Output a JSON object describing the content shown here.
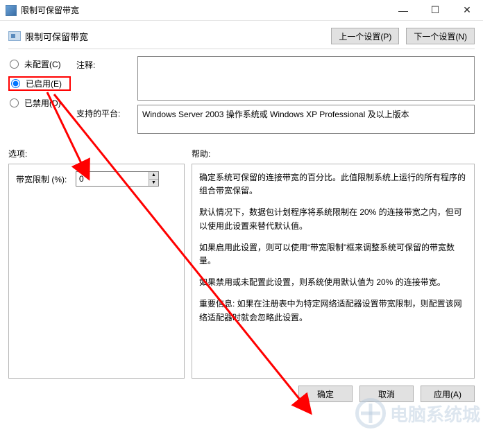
{
  "window": {
    "title": "限制可保留带宽",
    "min_icon": "—",
    "max_icon": "☐",
    "close_icon": "✕"
  },
  "header": {
    "title": "限制可保留带宽",
    "prev_btn": "上一个设置(P)",
    "next_btn": "下一个设置(N)"
  },
  "radios": {
    "not_configured": "未配置(C)",
    "enabled": "已启用(E)",
    "disabled": "已禁用(D)",
    "selected": "enabled"
  },
  "comment": {
    "label": "注释:",
    "value": ""
  },
  "platform": {
    "label": "支持的平台:",
    "value": "Windows Server 2003 操作系统或 Windows XP Professional 及以上版本"
  },
  "section_labels": {
    "options": "选项:",
    "help": "帮助:"
  },
  "options": {
    "bandwidth_label": "带宽限制 (%):",
    "bandwidth_value": "0"
  },
  "help": {
    "p1": "确定系统可保留的连接带宽的百分比。此值限制系统上运行的所有程序的组合带宽保留。",
    "p2": "默认情况下，数据包计划程序将系统限制在 20% 的连接带宽之内，但可以使用此设置来替代默认值。",
    "p3": "如果启用此设置，则可以使用“带宽限制”框来调整系统可保留的带宽数量。",
    "p4": "如果禁用或未配置此设置，则系统使用默认值为 20% 的连接带宽。",
    "p5": "重要信息: 如果在注册表中为特定网络适配器设置带宽限制，则配置该网络适配器时就会忽略此设置。"
  },
  "footer": {
    "ok": "确定",
    "cancel": "取消",
    "apply": "应用(A)"
  },
  "annotations": {
    "highlight_color": "#ff0000"
  }
}
